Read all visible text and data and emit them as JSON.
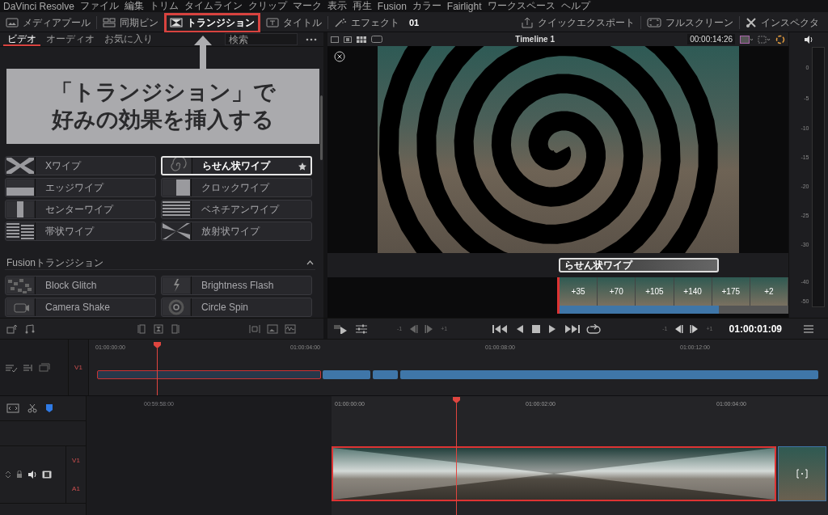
{
  "menu_bar": {
    "app_name": "DaVinci Resolve",
    "items": [
      "ファイル",
      "編集",
      "トリム",
      "タイムライン",
      "クリップ",
      "マーク",
      "表示",
      "再生",
      "Fusion",
      "カラー",
      "Fairlight",
      "ワークスペース",
      "ヘルプ"
    ]
  },
  "toolbar": {
    "left": [
      {
        "label": "メディアプール",
        "kind": "media",
        "selected": false,
        "annotated": false
      },
      {
        "label": "同期ビン",
        "kind": "sync",
        "selected": false,
        "annotated": false
      },
      {
        "label": "トランジション",
        "kind": "transition",
        "selected": true,
        "annotated": true
      },
      {
        "label": "タイトル",
        "kind": "title",
        "selected": false,
        "annotated": false
      },
      {
        "label": "エフェクト",
        "kind": "effects",
        "selected": false,
        "annotated": false
      }
    ],
    "title": "01",
    "right": [
      {
        "label": "クイックエクスポート",
        "kind": "export"
      },
      {
        "label": "フルスクリーン",
        "kind": "fullscreen"
      },
      {
        "label": "インスペクタ",
        "kind": "inspector"
      }
    ]
  },
  "effects_panel": {
    "tabs": [
      {
        "label": "ビデオ",
        "selected": true
      },
      {
        "label": "オーディオ",
        "selected": false
      },
      {
        "label": "お気に入り",
        "selected": false
      }
    ],
    "search": {
      "placeholder": "検索"
    },
    "wipe_items": [
      {
        "label": "Xワイプ",
        "kind": "cross",
        "selected": false,
        "favorite": false
      },
      {
        "label": "らせん状ワイプ",
        "kind": "spiral",
        "selected": true,
        "favorite": true
      },
      {
        "label": "エッジワイプ",
        "kind": "edge",
        "selected": false,
        "favorite": false
      },
      {
        "label": "クロックワイプ",
        "kind": "clock",
        "selected": false,
        "favorite": false
      },
      {
        "label": "センターワイプ",
        "kind": "center",
        "selected": false,
        "favorite": false
      },
      {
        "label": "ベネチアンワイプ",
        "kind": "venetian",
        "selected": false,
        "favorite": false
      },
      {
        "label": "帯状ワイプ",
        "kind": "band",
        "selected": false,
        "favorite": false
      },
      {
        "label": "放射状ワイプ",
        "kind": "radial",
        "selected": false,
        "favorite": false
      }
    ],
    "fusion_section": {
      "title": "Fusionトランジション",
      "expanded": true,
      "items": [
        {
          "label": "Block Glitch",
          "kind": "glitch",
          "selected": false,
          "favorite": false
        },
        {
          "label": "Brightness Flash",
          "kind": "flash",
          "selected": false,
          "favorite": false
        },
        {
          "label": "Camera Shake",
          "kind": "shake",
          "selected": false,
          "favorite": false
        },
        {
          "label": "Circle Spin",
          "kind": "spin",
          "selected": false,
          "favorite": false
        }
      ]
    }
  },
  "annotation": {
    "lines": [
      "「トランジション」で",
      "好みの効果を挿入する"
    ]
  },
  "viewer": {
    "timeline_name": "Timeline 1",
    "timecode": "00:00:14:26",
    "transition_label": "らせん状ワイプ",
    "frame_offsets": [
      "+35",
      "+70",
      "+105",
      "+140",
      "+175",
      "+2"
    ]
  },
  "audio_meter": {
    "ticks": [
      "0",
      "-5",
      "-10",
      "-15",
      "-20",
      "-25",
      "-30",
      "-40",
      "-50"
    ]
  },
  "transport": {
    "step_labels": [
      "-1",
      "+1",
      "-1",
      "+1"
    ],
    "timecode": "01:00:01:09"
  },
  "mini_timeline": {
    "ruler": [
      "01:00:00:00",
      "01:00:04:00",
      "01:00:08:00",
      "01:00:12:00"
    ],
    "track": "V1"
  },
  "timeline": {
    "ruler": [
      "00:59:58:00",
      "01:00:00:00",
      "01:00:02:00",
      "01:00:04:00"
    ],
    "tracks": [
      "V1",
      "A1"
    ]
  }
}
